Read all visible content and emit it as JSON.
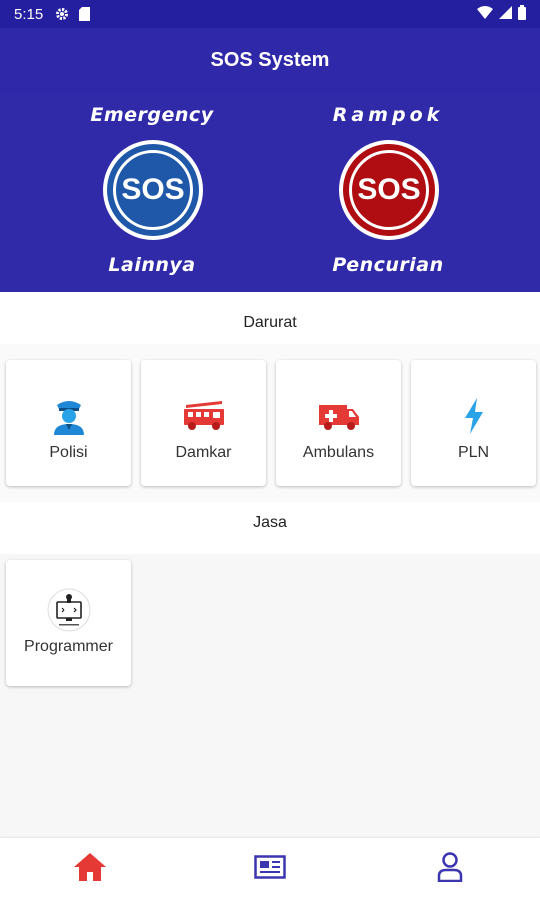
{
  "status_bar": {
    "time": "5:15"
  },
  "app_bar": {
    "title": "SOS System"
  },
  "hero": {
    "left": {
      "top_label": "Emergency",
      "button_text": "SOS",
      "bottom_label": "Lainnya",
      "color": "#1f58a8"
    },
    "right": {
      "top_label": "Rampok",
      "button_text": "SOS",
      "bottom_label": "Pencurian",
      "color": "#b00d12"
    }
  },
  "sections": {
    "darurat": {
      "title": "Darurat",
      "items": [
        {
          "label": "Polisi",
          "icon": "police-icon"
        },
        {
          "label": "Damkar",
          "icon": "fire-truck-icon"
        },
        {
          "label": "Ambulans",
          "icon": "ambulance-icon"
        },
        {
          "label": "PLN",
          "icon": "lightning-icon"
        }
      ]
    },
    "jasa": {
      "title": "Jasa",
      "items": [
        {
          "label": "Programmer",
          "icon": "programmer-icon"
        }
      ]
    }
  },
  "bottom_nav": [
    {
      "icon": "home-icon",
      "active": true
    },
    {
      "icon": "news-icon",
      "active": false
    },
    {
      "icon": "profile-icon",
      "active": false
    }
  ],
  "colors": {
    "primary": "#302aa9",
    "active_nav": "#e53935",
    "inactive_nav": "#3b35b0"
  }
}
